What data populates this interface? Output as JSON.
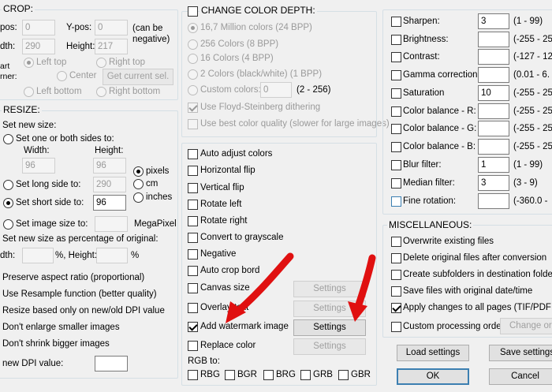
{
  "crop": {
    "title": "CROP:",
    "xpos_label": "pos:",
    "xpos_value": "0",
    "ypos_label": "Y-pos:",
    "ypos_value": "0",
    "can_be_negative": "(can be\nnegative)",
    "width_label": "dth:",
    "width_value": "290",
    "height_label": "Height:",
    "height_value": "217",
    "corner_label_1": "art",
    "corner_label_2": "rner:",
    "left_top": "Left top",
    "right_top": "Right top",
    "center": "Center",
    "get_current": "Get current sel.",
    "left_bottom": "Left bottom",
    "right_bottom": "Right bottom"
  },
  "resize": {
    "title": "RESIZE:",
    "set_new_size": "Set new size:",
    "one_or_both": "Set one or both sides to:",
    "width_label": "Width:",
    "height_label": "Height:",
    "width_value": "96",
    "height_value": "96",
    "long_side": "Set long side to:",
    "long_value": "290",
    "short_side": "Set short side to:",
    "short_value": "96",
    "image_size": "Set image size to:",
    "image_size_value": "",
    "megapixel": "MegaPixel",
    "unit_pixels": "pixels",
    "unit_cm": "cm",
    "unit_inches": "inches",
    "percentage": "Set new size as percentage of original:",
    "pct_width_label": "dth:",
    "pct_width_value": "",
    "pct_sep": "%, Height:",
    "pct_height_value": "",
    "pct_end": "%",
    "preserve": "Preserve aspect ratio (proportional)",
    "resample": "Use Resample function (better quality)",
    "dpi_based": "Resize based only on new/old DPI value",
    "dont_enlarge": "Don't enlarge smaller images",
    "dont_shrink": "Don't shrink bigger images",
    "new_dpi": "new DPI value:",
    "new_dpi_value": ""
  },
  "color_depth": {
    "title": "CHANGE COLOR DEPTH:",
    "opt1": "16,7 Million colors (24 BPP)",
    "opt2": "256 Colors (8 BPP)",
    "opt3": "16 Colors (4 BPP)",
    "opt4": "2 Colors (black/white) (1 BPP)",
    "custom": "Custom colors:",
    "custom_value": "0",
    "custom_range": "(2 - 256)",
    "floyd": "Use Floyd-Steinberg dithering",
    "best_quality": "Use best color quality (slower for large images)"
  },
  "middle": {
    "auto_adjust": "Auto adjust colors",
    "hflip": "Horizontal flip",
    "vflip": "Vertical flip",
    "rotate_left": "Rotate left",
    "rotate_right": "Rotate right",
    "grayscale": "Convert to grayscale",
    "negative": "Negative",
    "auto_crop": "Auto crop bord",
    "canvas": "Canvas size",
    "overlay": "Overlay text",
    "watermark": "Add watermark image",
    "replace_color": "Replace color",
    "settings": "Settings",
    "rgb_to": "RGB to:",
    "rgb_opts": [
      "RBG",
      "BGR",
      "BRG",
      "GRB",
      "GBR"
    ]
  },
  "adjust": {
    "rows": [
      {
        "label": "Sharpen:",
        "value": "3",
        "range": "(1 - 99)"
      },
      {
        "label": "Brightness:",
        "value": "",
        "range": "(-255 - 25"
      },
      {
        "label": "Contrast:",
        "value": "",
        "range": "(-127 - 12"
      },
      {
        "label": "Gamma correction:",
        "value": "",
        "range": "(0.01 - 6."
      },
      {
        "label": "Saturation",
        "value": "10",
        "range": "(-255 - 25"
      },
      {
        "label": "Color balance - R:",
        "value": "",
        "range": "(-255 - 25"
      },
      {
        "label": "Color balance - G:",
        "value": "",
        "range": "(-255 - 25"
      },
      {
        "label": "Color balance - B:",
        "value": "",
        "range": "(-255 - 25"
      },
      {
        "label": "Blur filter:",
        "value": "1",
        "range": "(1 - 99)"
      },
      {
        "label": "Median filter:",
        "value": "3",
        "range": "(3 - 9)"
      },
      {
        "label": "Fine rotation:",
        "value": "",
        "range": "(-360.0 -"
      }
    ]
  },
  "misc": {
    "title": "MISCELLANEOUS:",
    "overwrite": "Overwrite existing files",
    "delete_orig": "Delete original files after conversion",
    "subfolders": "Create subfolders in destination folder",
    "save_orig_date": "Save files with original date/time",
    "apply_all": "Apply changes to all pages (TIF/PDF sa",
    "custom_order": "Custom processing order",
    "change_order": "Change ord"
  },
  "footer": {
    "load": "Load settings",
    "save": "Save settings",
    "ok": "OK",
    "cancel": "Cancel"
  },
  "colors": {
    "annotation_arrow": "#e01010",
    "focus_blue": "#3c7fb1"
  }
}
